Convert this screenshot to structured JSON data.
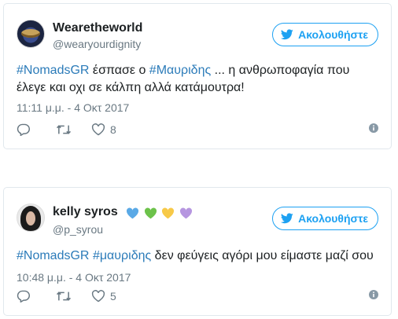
{
  "tweets": [
    {
      "display_name": "Wearetheworld",
      "handle": "@wearyourdignity",
      "follow_label": "Ακολουθήστε",
      "text_parts": [
        {
          "kind": "hashtag",
          "text": "#NomadsGR"
        },
        {
          "kind": "plain",
          "text": " έσπασε ο "
        },
        {
          "kind": "hashtag",
          "text": "#Μαυριδης"
        },
        {
          "kind": "plain",
          "text": " ... η ανθρωποφαγία που έλεγε και οχι σε κάλπη αλλά κατάμουτρα!"
        }
      ],
      "timestamp": "11:11 μ.μ. - 4 Οκτ 2017",
      "like_count": "8"
    },
    {
      "display_name": "kelly syros",
      "handle": "@p_syrou",
      "follow_label": "Ακολουθήστε",
      "text_parts": [
        {
          "kind": "hashtag",
          "text": "#NomadsGR"
        },
        {
          "kind": "plain",
          "text": " "
        },
        {
          "kind": "hashtag",
          "text": "#μαυριδης"
        },
        {
          "kind": "plain",
          "text": " δεν φεύγεις αγόρι μου είμαστε μαζί σου"
        }
      ],
      "timestamp": "10:48 μ.μ. - 4 Οκτ 2017",
      "like_count": "5",
      "name_hearts": [
        "#5aa9e6",
        "#6cc24a",
        "#f7c948",
        "#b696e0"
      ]
    }
  ],
  "colors": {
    "accent": "#1da1f2",
    "hashtag": "#2b7bb9",
    "muted": "#697882"
  },
  "icons": {
    "follow": "twitter-bird-icon",
    "reply": "reply-icon",
    "retweet": "retweet-icon",
    "like": "heart-icon",
    "info": "info-icon"
  }
}
